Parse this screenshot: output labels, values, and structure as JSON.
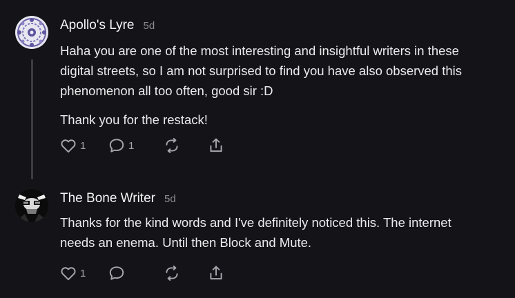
{
  "comments": [
    {
      "author": "Apollo's Lyre",
      "time": "5d",
      "paragraphs": [
        [
          "Haha you are one of the most interesting and insightful writers in these",
          "digital streets, so I am not surprised to find you have also observed this",
          "phenomenon all too often, good sir :D"
        ],
        [
          "Thank you for the restack!"
        ]
      ],
      "like_count": "1",
      "reply_count": "1"
    },
    {
      "author": "The Bone Writer",
      "time": "5d",
      "paragraphs": [
        [
          "Thanks for the kind words and I've definitely noticed this. The internet",
          "needs an enema. Until then Block and Mute."
        ]
      ],
      "like_count": "1",
      "reply_count": ""
    }
  ],
  "icons": {
    "like": "heart-icon",
    "reply": "comment-bubble-icon",
    "restack": "restack-icon",
    "share": "share-icon"
  },
  "colors": {
    "background": "#141418",
    "text": "#f2f2f4",
    "muted": "#8c8c93",
    "icon": "#a6a6ad",
    "thread_line": "#3c3c42"
  }
}
